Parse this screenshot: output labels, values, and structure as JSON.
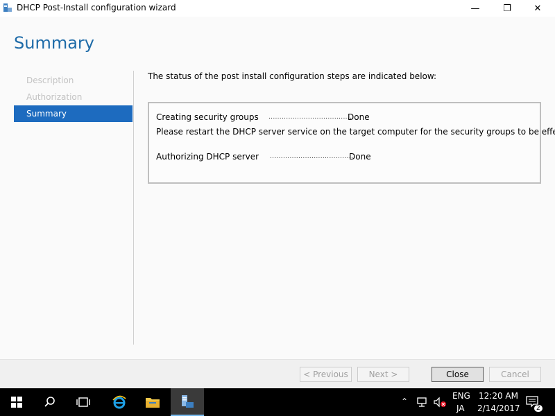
{
  "window": {
    "title": "DHCP Post-Install configuration wizard",
    "minimize_symbol": "—",
    "restore_symbol": "❐",
    "close_symbol": "✕"
  },
  "page_title": "Summary",
  "nav": {
    "items": [
      {
        "label": "Description",
        "state": "disabled"
      },
      {
        "label": "Authorization",
        "state": "disabled"
      },
      {
        "label": "Summary",
        "state": "active"
      }
    ]
  },
  "main": {
    "intro": "The status of the post install configuration steps are indicated below:",
    "steps": [
      {
        "label": "Creating security groups",
        "dots": "........................................",
        "status": "Done"
      },
      {
        "message": "Please restart the DHCP server service on the target computer for the security groups to be effective."
      },
      {
        "label": "Authorizing DHCP server",
        "dots": "........................................",
        "status": "Done"
      }
    ]
  },
  "footer": {
    "previous_label": "< Previous",
    "next_label": "Next >",
    "close_label": "Close",
    "cancel_label": "Cancel"
  },
  "taskbar": {
    "language": "ENG",
    "ime": "JA",
    "time": "12:20 AM",
    "date": "2/14/2017",
    "notification_count": "2",
    "accent_color": "#76b9ed"
  },
  "colors": {
    "title_blue": "#1e6ba8",
    "nav_active": "#1d6bbf"
  }
}
